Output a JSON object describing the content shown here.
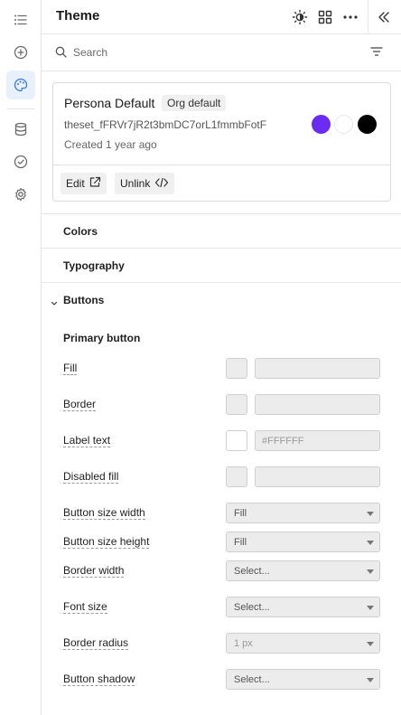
{
  "rail": {
    "items": [
      {
        "icon": "list-icon"
      },
      {
        "icon": "plus-circle-icon"
      },
      {
        "icon": "palette-icon",
        "active": true
      },
      {
        "icon": "database-icon"
      },
      {
        "icon": "check-circle-icon"
      },
      {
        "icon": "gear-icon"
      }
    ]
  },
  "header": {
    "title": "Theme",
    "icons": [
      "theme-mode-icon",
      "grid-icon",
      "more-icon",
      "collapse-icon"
    ]
  },
  "search": {
    "placeholder": "Search",
    "value": ""
  },
  "theme_card": {
    "name": "Persona Default",
    "badge": "Org default",
    "id": "theset_fFRVr7jR2t3bmDC7orL1fmmbFotF",
    "created": "Created 1 year ago",
    "swatches": [
      "#6a2cf0",
      "#ffffff",
      "#000000"
    ],
    "edit_label": "Edit",
    "unlink_label": "Unlink"
  },
  "sections": {
    "colors": "Colors",
    "typography": "Typography",
    "buttons": "Buttons"
  },
  "buttons_section": {
    "subtitle": "Primary button",
    "fill_label": "Fill",
    "border_label": "Border",
    "label_text_label": "Label text",
    "label_text_value": "#FFFFFF",
    "disabled_fill_label": "Disabled fill",
    "size_width_label": "Button size width",
    "size_width_value": "Fill",
    "size_height_label": "Button size height",
    "size_height_value": "Fill",
    "border_width_label": "Border width",
    "border_width_value": "Select...",
    "font_size_label": "Font size",
    "font_size_value": "Select...",
    "border_radius_label": "Border radius",
    "border_radius_value": "1 px",
    "shadow_label": "Button shadow",
    "shadow_value": "Select..."
  },
  "colors": {
    "accent_bg": "#e8f0fb",
    "accent": "#3a7bd5",
    "border": "#e6e6e6"
  }
}
